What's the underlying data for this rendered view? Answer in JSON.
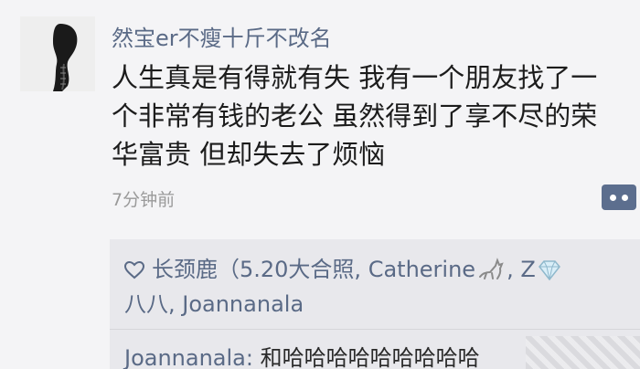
{
  "post": {
    "username": "然宝er不瘦十斤不改名",
    "text": "人生真是有得就有失 我有一个朋友找了一个非常有钱的老公 虽然得到了享不尽的荣华富贵 但却失去了烦恼",
    "time": "7分钟前"
  },
  "likes": {
    "icon": "heart-outline-icon",
    "part1": "长颈鹿（5.20大合照, Catherine",
    "part2": ", Z",
    "part3": "八八, Joannanala"
  },
  "comment": {
    "author": "Joannanala:",
    "text": " 和哈哈哈哈哈哈哈哈哈"
  },
  "colors": {
    "name": "#5a6a86",
    "body": "#1c1c1c",
    "time": "#9a9a9a",
    "box": "#e8e8ec",
    "more_button": "#5c6e8e"
  }
}
